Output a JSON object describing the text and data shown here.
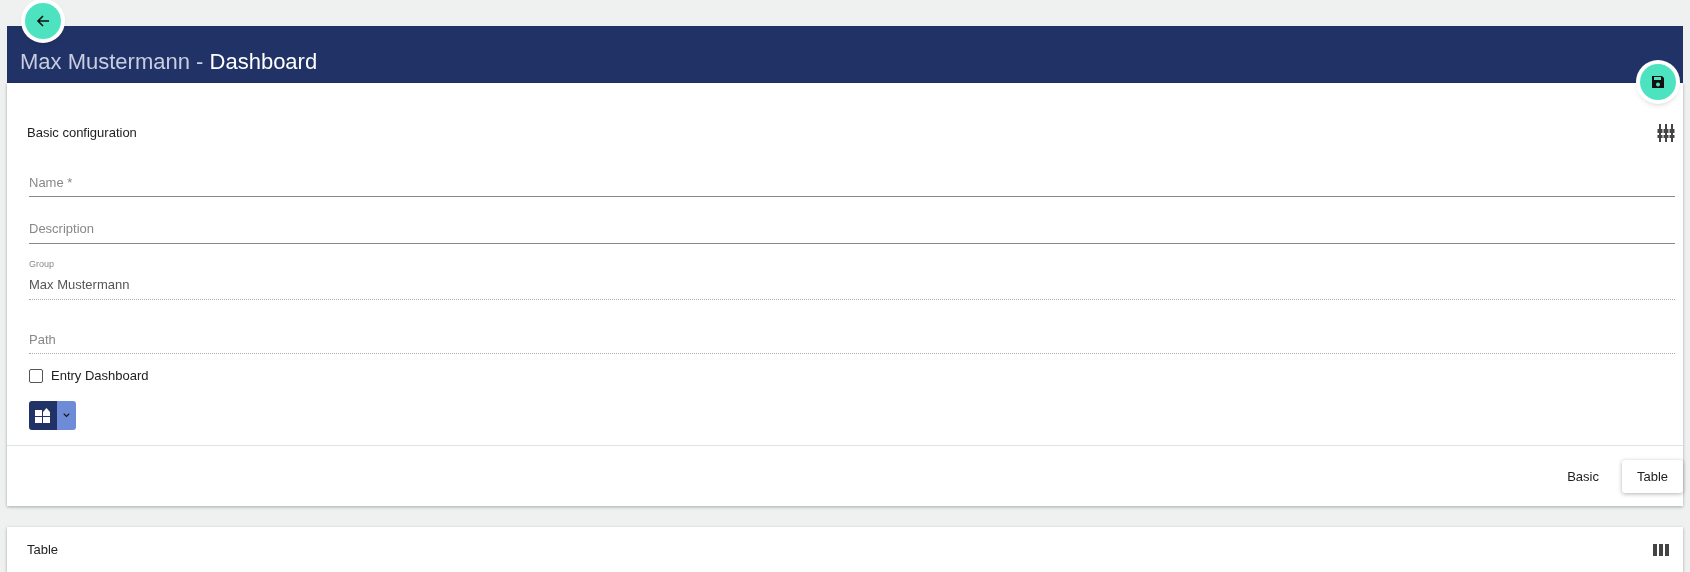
{
  "header": {
    "owner": "Max Mustermann",
    "separator": "-",
    "title": "Dashboard"
  },
  "basic_section": {
    "title": "Basic configuration",
    "fields": [
      {
        "kind": "input",
        "placeholder": "Name *"
      },
      {
        "kind": "input",
        "placeholder": "Description"
      },
      {
        "kind": "readonly",
        "label": "Group",
        "value": "Max Mustermann"
      },
      {
        "kind": "readonly",
        "placeholder": "Path"
      }
    ],
    "entry_dashboard": {
      "label": "Entry Dashboard",
      "checked": false
    },
    "tabs": [
      {
        "label": "Basic",
        "selected": false
      },
      {
        "label": "Table",
        "selected": true
      }
    ]
  },
  "table_section": {
    "title": "Table"
  }
}
